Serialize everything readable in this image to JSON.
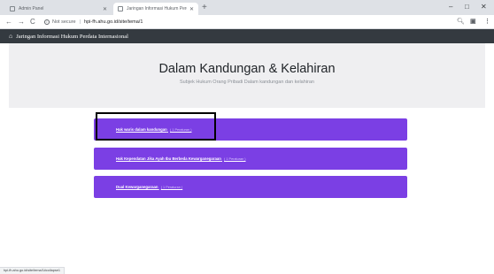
{
  "browser": {
    "tabs": [
      {
        "label": "Admin Panel",
        "active": false
      },
      {
        "label": "Jaringan Informasi Hukum Perd...",
        "active": true
      }
    ],
    "new_tab": "+",
    "window_controls": {
      "minimize": "–",
      "maximize": "□",
      "close": "✕"
    },
    "nav": {
      "back": "←",
      "forward": "→",
      "reload": "C"
    },
    "security_label": "Not secure",
    "url": "hpi-fh.ahu.go.id/site/tema/1",
    "status_url": "hpi-fh.ahu.go.id/site/tema/1#collapse1"
  },
  "site": {
    "brand": "Jaringan Informasi Hukum Perdata Internasional"
  },
  "hero": {
    "title": "Dalam Kandungan & Kelahiran",
    "subtitle": "Subjek Hukum Orang Pribadi Dalam kandungan dan kelahiran"
  },
  "cards": [
    {
      "title": "Hak waris dalam kandungan",
      "count": "( 1 Peraturan )"
    },
    {
      "title": "Hak Kependatan Jika Ayah Ibu Berbeda Kewarganegaraan",
      "count": "( 1 Peraturan )"
    },
    {
      "title": "Dual Kewarganegaraan",
      "count": "( 1 Peraturan )"
    }
  ],
  "colors": {
    "card": "#7b3fe4",
    "navbar": "#343a40",
    "hero": "#efeff1"
  }
}
